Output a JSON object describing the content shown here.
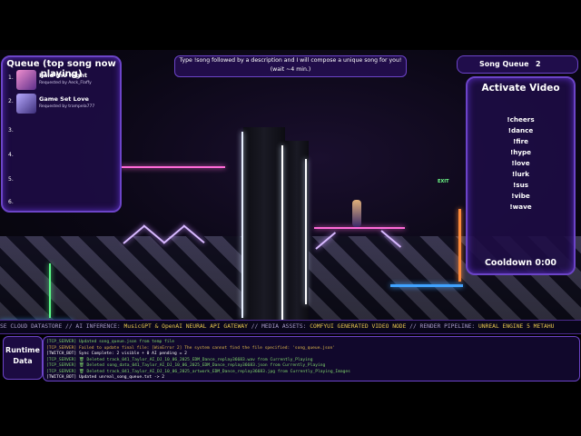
{
  "queue": {
    "title": "Queue (top song now playing)",
    "items": [
      {
        "num": "1.",
        "song": "Raid the Night",
        "by": "Requested by Aeck_Flaffy",
        "thumb_color": "#c56fb0"
      },
      {
        "num": "2.",
        "song": "Game Set Love",
        "by": "Requested by trampela777",
        "thumb_color": "#8f7fd6"
      },
      {
        "num": "3.",
        "song": "",
        "by": ""
      },
      {
        "num": "4.",
        "song": "",
        "by": ""
      },
      {
        "num": "5.",
        "song": "",
        "by": ""
      },
      {
        "num": "6.",
        "song": "",
        "by": ""
      }
    ]
  },
  "instructions": {
    "line1": "Type !song followed by a description and I will compose a unique song for you!",
    "line2": "(wait ~4 min.)"
  },
  "song_queue": {
    "label": "Song Queue",
    "count": "2"
  },
  "activate_video": {
    "title": "Activate Video",
    "commands": [
      "!cheers",
      "!dance",
      "!fire",
      "!hype",
      "!love",
      "!lurk",
      "!sus",
      "!vibe",
      "!wave"
    ],
    "cooldown": "Cooldown 0:00"
  },
  "scene": {
    "sign_text": "EXIT"
  },
  "ticker": [
    {
      "text": "SE CLOUD DATASTORE // AI INFERENCE: ",
      "hl": false
    },
    {
      "text": "MusicGPT & OpenAI NEURAL API GATEWAY",
      "hl": true
    },
    {
      "text": " // MEDIA ASSETS: ",
      "hl": false
    },
    {
      "text": "COMFYUI GENERATED VIDEO NODE",
      "hl": true
    },
    {
      "text": " // RENDER PIPELINE: ",
      "hl": false
    },
    {
      "text": "UNREAL ENGINE 5 METAHU",
      "hl": true
    }
  ],
  "runtime": {
    "label_line1": "Runtime",
    "label_line2": "Data"
  },
  "log": [
    {
      "text": "[TCP_SERVER] Updated song_queue.json from temp file",
      "color": "#7fd46b"
    },
    {
      "text": "[TCP_SERVER] Failed to update final file: [WinError 2] The system cannot find the file specified: 'song_queue.json'",
      "color": "#e0b84a"
    },
    {
      "text": "[TWITCH_BOT] Sync Complete: 2 visible + 0 AI pending = 2",
      "color": "#ffffff"
    },
    {
      "text": "[TCP_SERVER] 🗑 Deleted track_041_Taylor_AI_DJ_10_06_2025_EDM_Dance_replay36683.wav from Currently_Playing",
      "color": "#7fd46b"
    },
    {
      "text": "[TCP_SERVER] 🗑 Deleted song_data_041_Taylor_AI_DJ_10_06_2025_EDM_Dance_replay36683.json from Currently_Playing",
      "color": "#7fd46b"
    },
    {
      "text": "[TCP_SERVER] 🗑 Deleted track_041_Taylor_AI_DJ_10_06_2025_artwork_EDM_Dance_replay36683.jpg from Currently_Playing_Images",
      "color": "#7fd46b"
    },
    {
      "text": "[TWITCH_BOT] Updated unreal_song_queue.txt -> 2",
      "color": "#ffffff"
    }
  ],
  "colors": {
    "panel_bg": "#1e0c46",
    "panel_border": "#6c44c8",
    "neon_pink": "#ff3fd0",
    "neon_blue": "#3fa2ff",
    "ticker_highlight": "#e9c84e"
  }
}
